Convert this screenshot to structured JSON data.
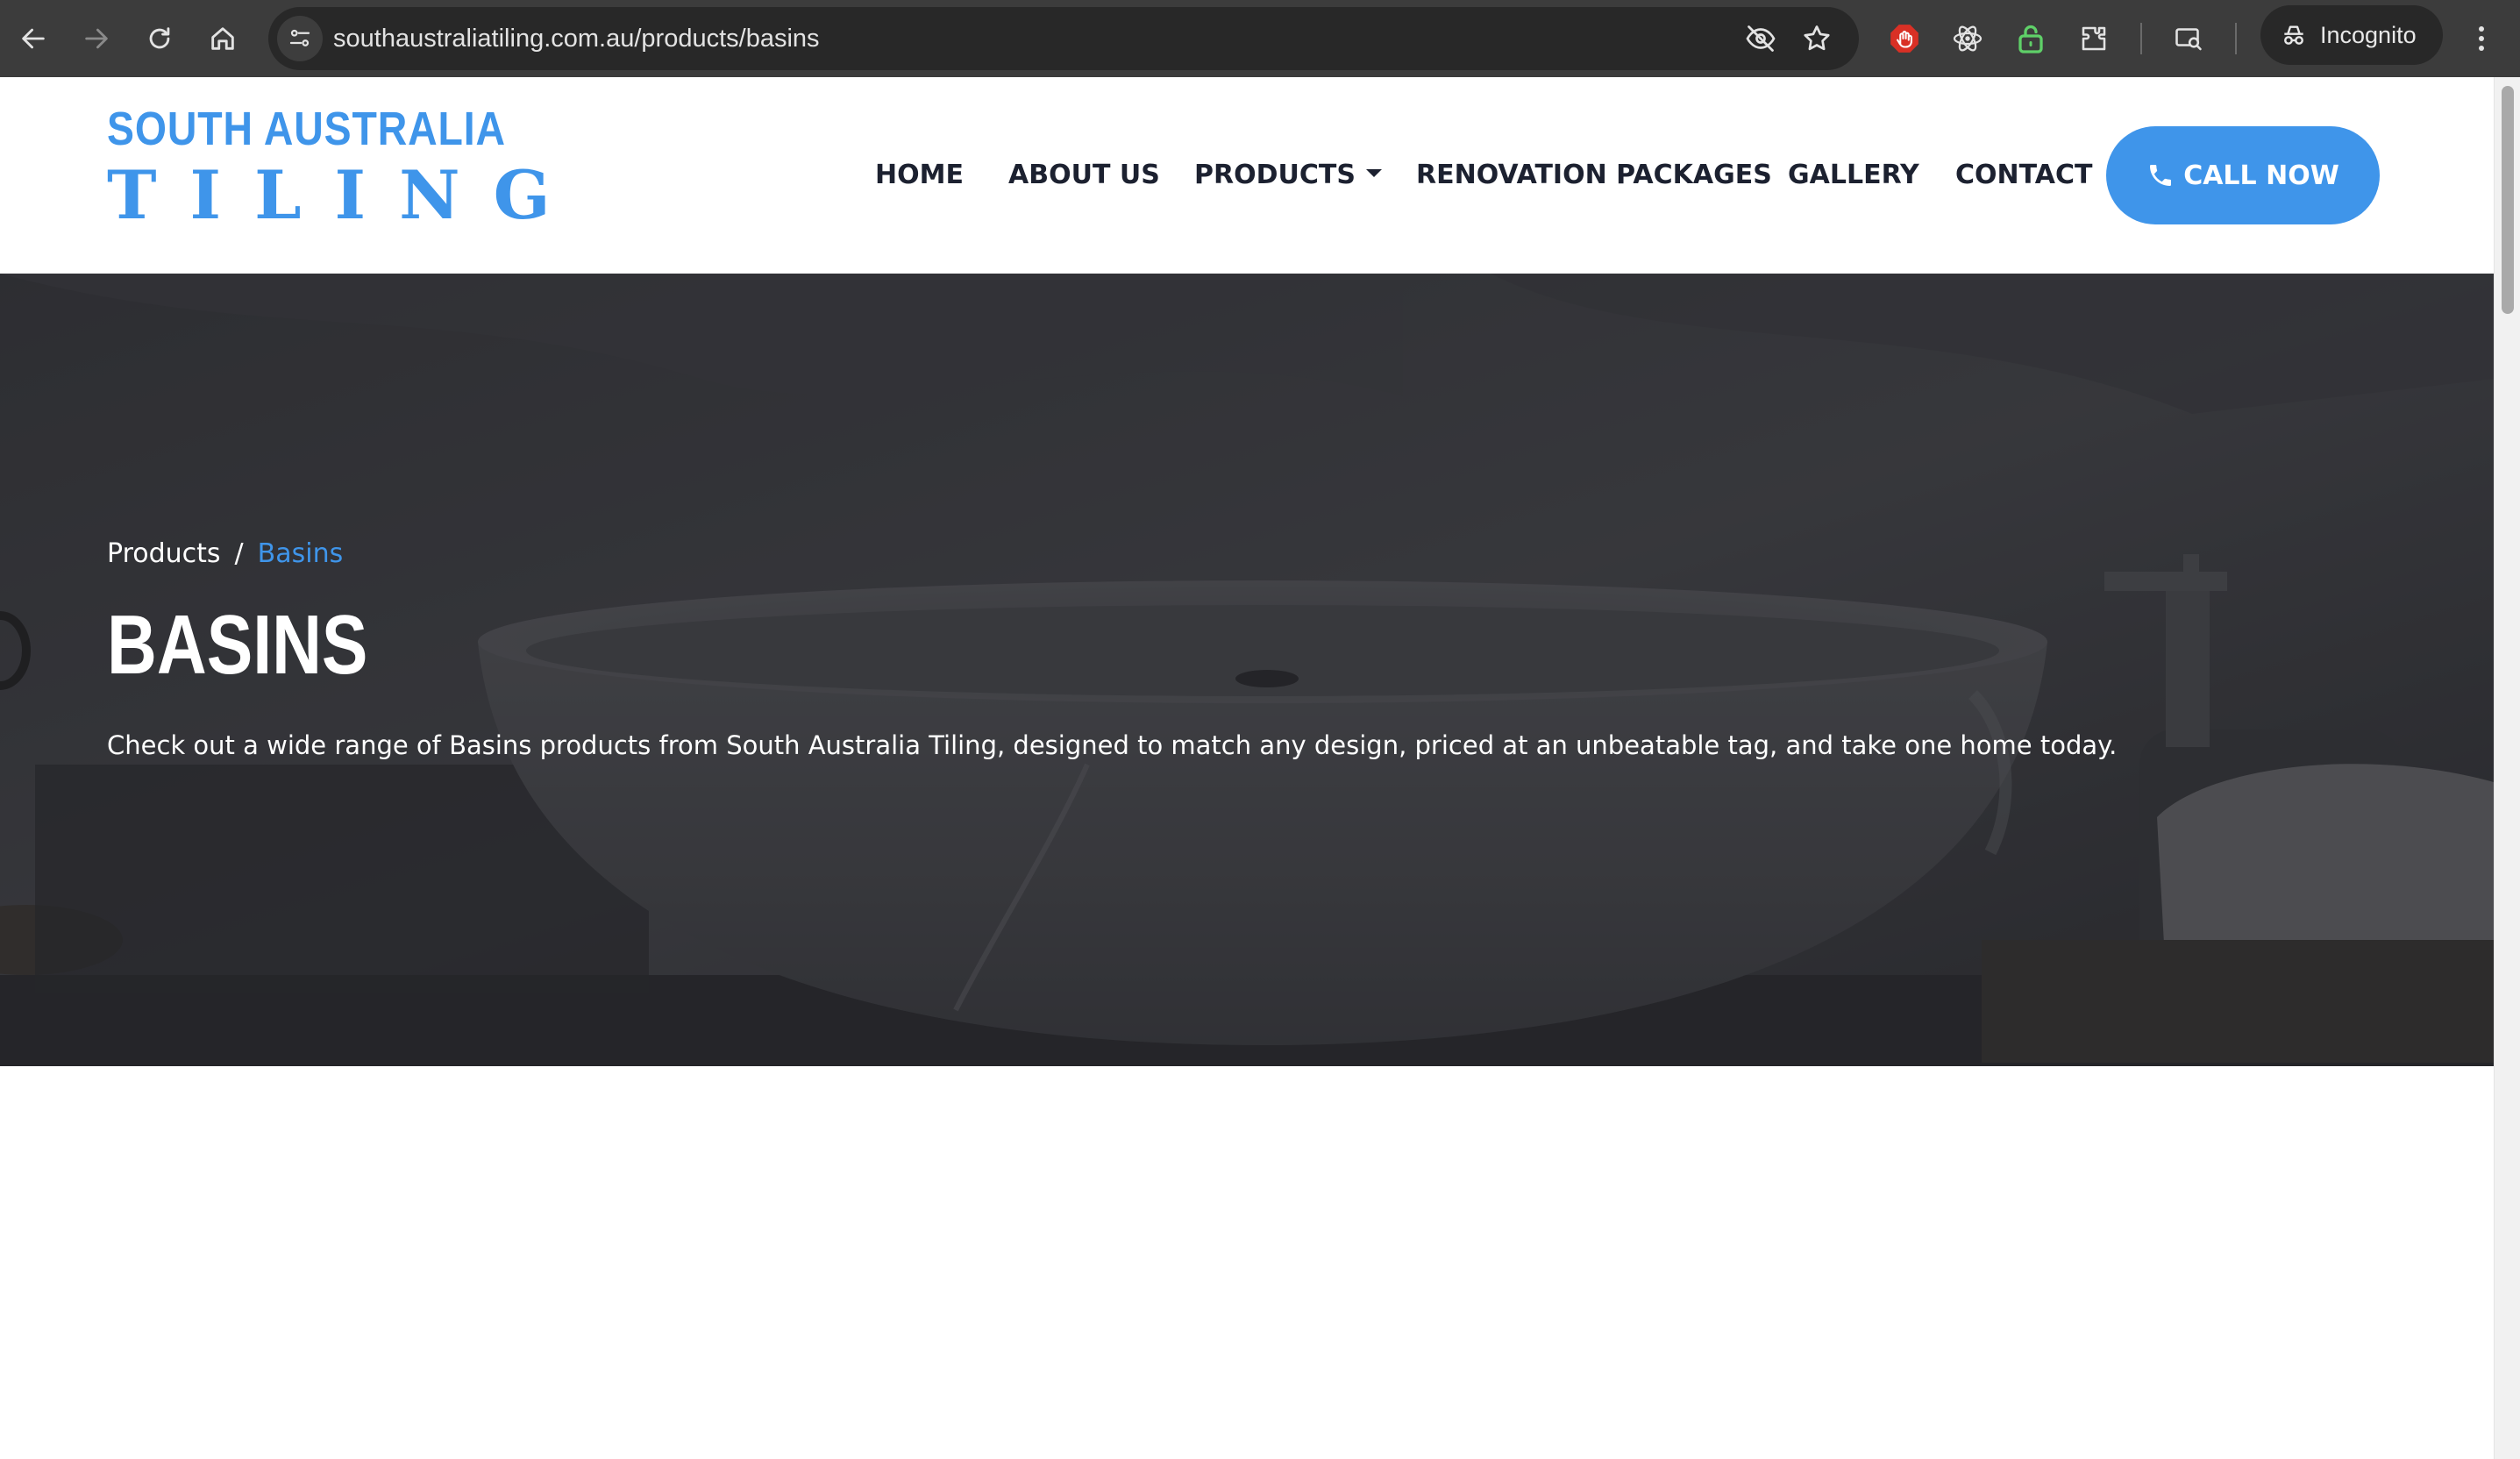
{
  "browser": {
    "url": "southaustraliatiling.com.au/products/basins",
    "profile_label": "Incognito",
    "icons": [
      "back-icon",
      "forward-icon",
      "reload-icon",
      "home-icon",
      "site-info-icon",
      "eye-off-icon",
      "star-icon",
      "adblock-icon",
      "react-devtools-icon",
      "lock-extension-icon",
      "extensions-icon",
      "reading-mode-icon",
      "incognito-icon",
      "more-icon"
    ]
  },
  "site": {
    "logo_top": "SOUTH AUSTRALIA",
    "logo_bottom": "TILING",
    "nav": {
      "home": "HOME",
      "about": "ABOUT US",
      "products": "PRODUCTS",
      "renovation": "RENOVATION PACKAGES",
      "gallery": "GALLERY",
      "contact": "CONTACT"
    },
    "call_button": "CALL NOW",
    "accent_color": "#3f95ea"
  },
  "hero": {
    "breadcrumb_parent": "Products",
    "breadcrumb_separator": "/",
    "breadcrumb_current": "Basins",
    "title": "BASINS",
    "description": "Check out a wide range of Basins products from South Australia Tiling, designed to match any design, priced at an unbeatable tag, and take one home today."
  }
}
